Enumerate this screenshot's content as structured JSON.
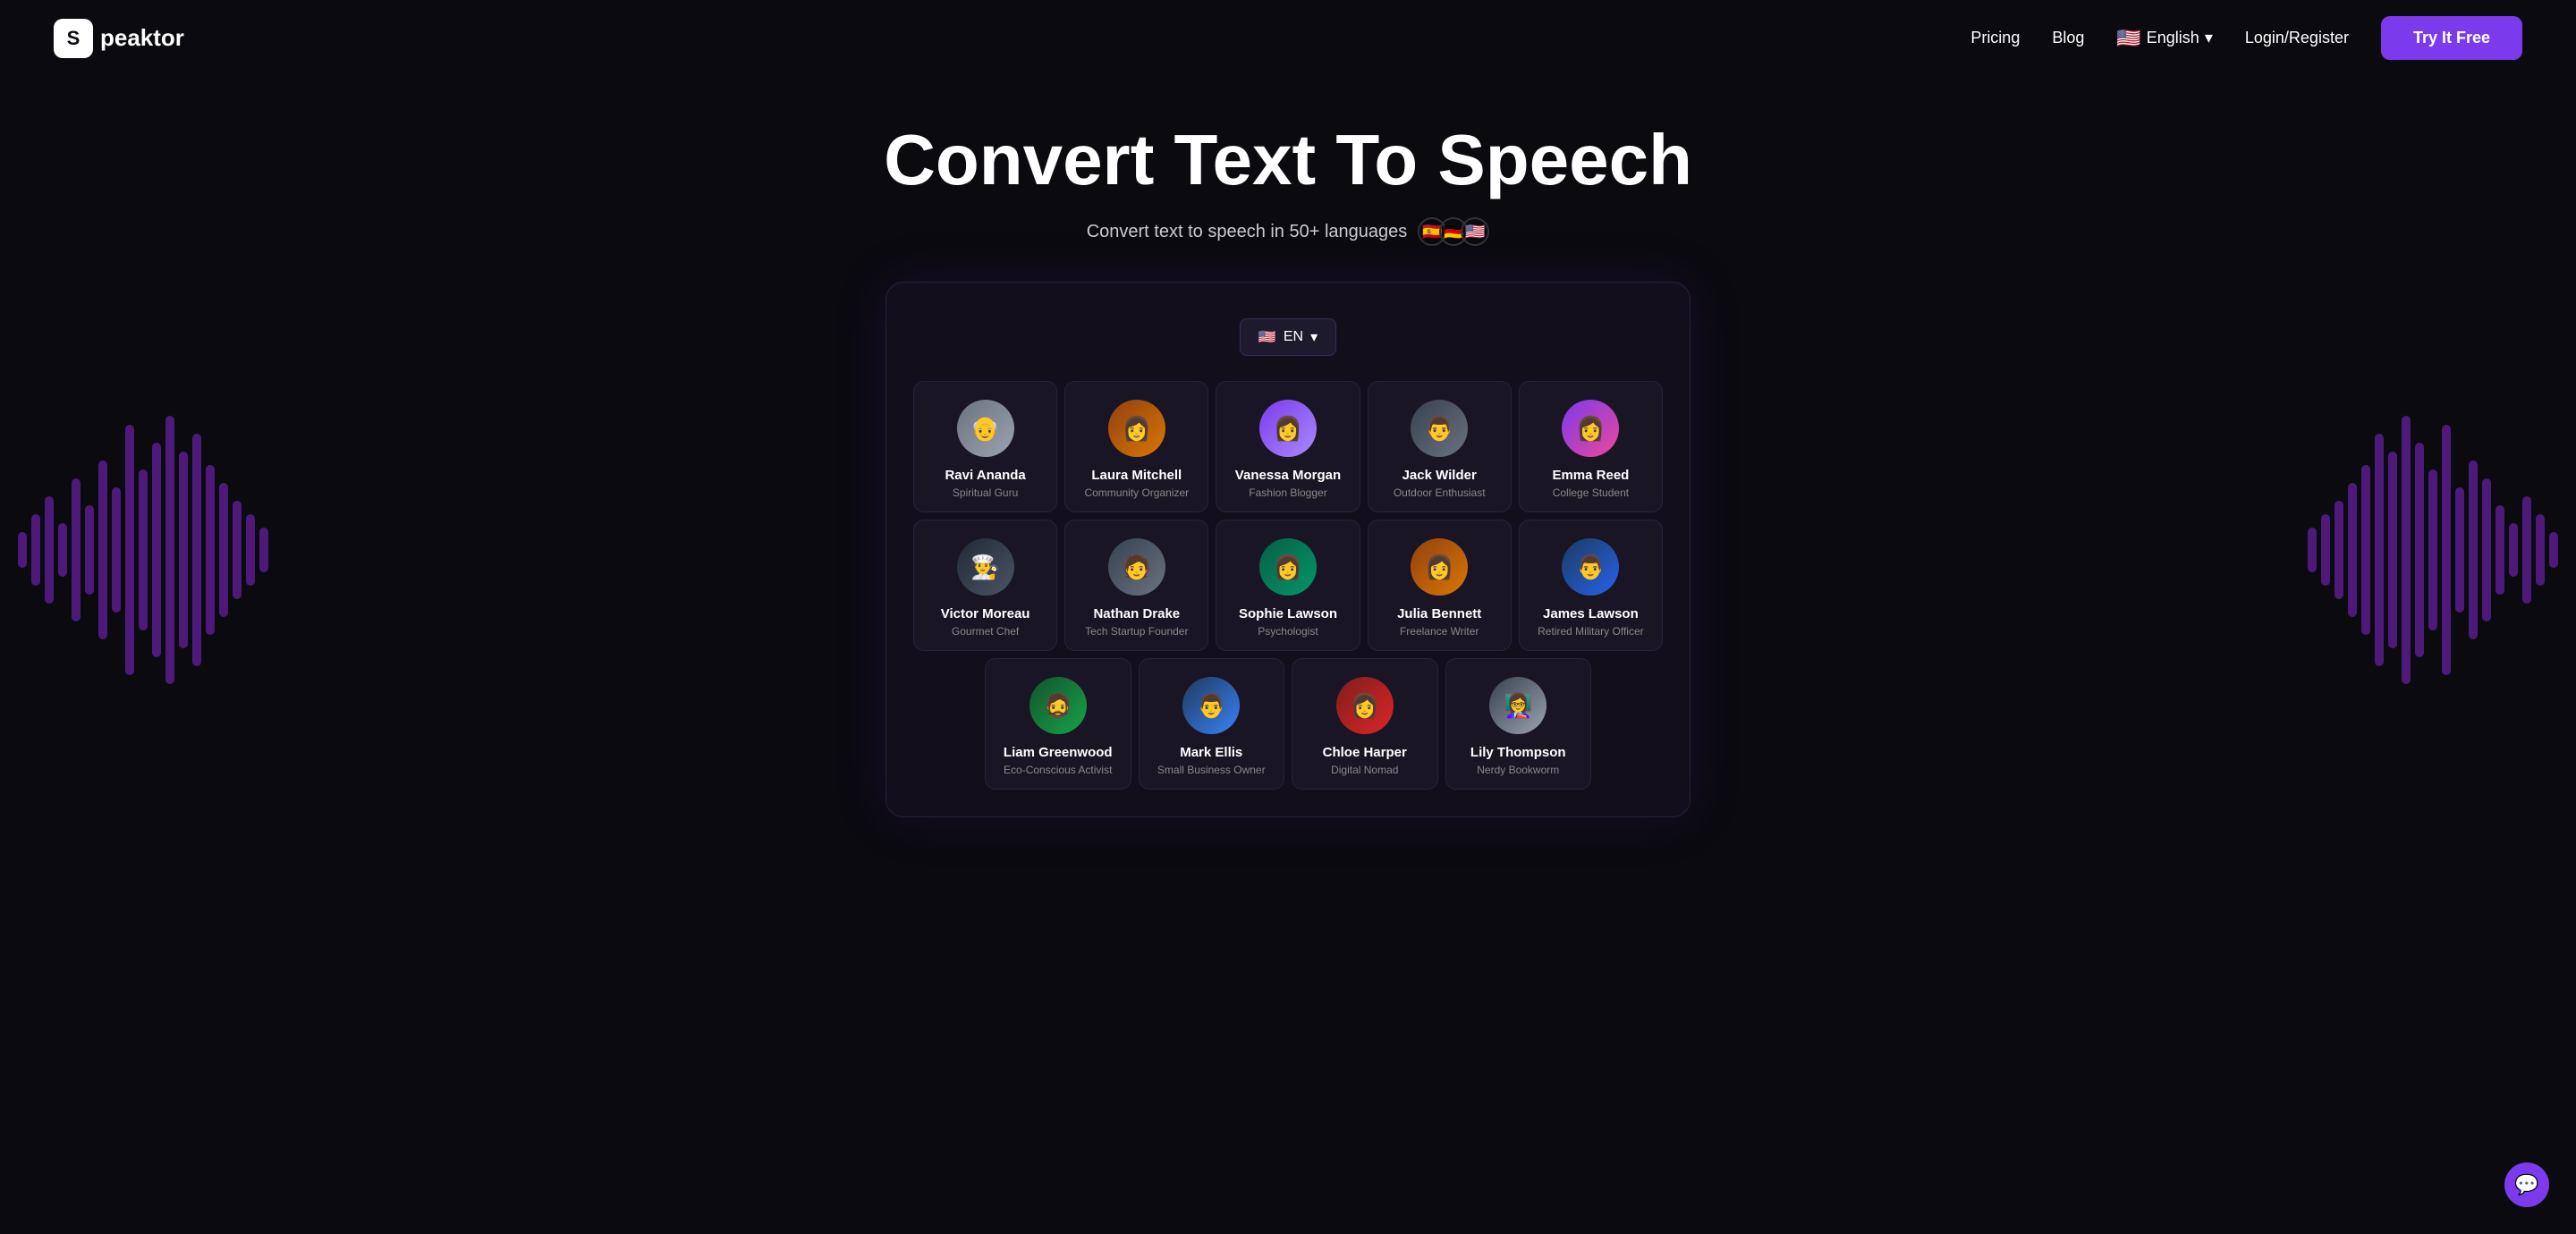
{
  "nav": {
    "logo_letter": "S",
    "logo_name": "peaktor",
    "pricing_label": "Pricing",
    "blog_label": "Blog",
    "language": "English",
    "login_label": "Login/Register",
    "try_free_label": "Try It Free"
  },
  "hero": {
    "title": "Convert Text To Speech",
    "subtitle": "Convert text to speech in 50+ languages",
    "flags": [
      "🇪🇸",
      "🇩🇪",
      "🇺🇸"
    ]
  },
  "app": {
    "lang_selector": "EN",
    "voices_row1": [
      {
        "name": "Ravi Ananda",
        "role": "Spiritual Guru",
        "avatar_class": "av-ravi",
        "emoji": "👴"
      },
      {
        "name": "Laura Mitchell",
        "role": "Community Organizer",
        "avatar_class": "av-laura",
        "emoji": "👩"
      },
      {
        "name": "Vanessa Morgan",
        "role": "Fashion Blogger",
        "avatar_class": "av-vanessa",
        "emoji": "👩"
      },
      {
        "name": "Jack Wilder",
        "role": "Outdoor Enthusiast",
        "avatar_class": "av-jack",
        "emoji": "👨"
      },
      {
        "name": "Emma Reed",
        "role": "College Student",
        "avatar_class": "av-emma",
        "emoji": "👩"
      }
    ],
    "voices_row2": [
      {
        "name": "Victor Moreau",
        "role": "Gourmet Chef",
        "avatar_class": "av-victor",
        "emoji": "👨‍🍳"
      },
      {
        "name": "Nathan Drake",
        "role": "Tech Startup Founder",
        "avatar_class": "av-nathan",
        "emoji": "🧑"
      },
      {
        "name": "Sophie Lawson",
        "role": "Psychologist",
        "avatar_class": "av-sophie",
        "emoji": "👩"
      },
      {
        "name": "Julia Bennett",
        "role": "Freelance Writer",
        "avatar_class": "av-julia",
        "emoji": "👩"
      },
      {
        "name": "James Lawson",
        "role": "Retired Military Officer",
        "avatar_class": "av-james",
        "emoji": "👨"
      }
    ],
    "voices_row3": [
      {
        "name": "Liam Greenwood",
        "role": "Eco-Conscious Activist",
        "avatar_class": "av-liam",
        "emoji": "🧔"
      },
      {
        "name": "Mark Ellis",
        "role": "Small Business Owner",
        "avatar_class": "av-mark",
        "emoji": "👨"
      },
      {
        "name": "Chloe Harper",
        "role": "Digital Nomad",
        "avatar_class": "av-chloe",
        "emoji": "👩"
      },
      {
        "name": "Lily Thompson",
        "role": "Nerdy Bookworm",
        "avatar_class": "av-lily",
        "emoji": "👩‍🏫"
      }
    ]
  },
  "chat": {
    "icon": "💬"
  }
}
